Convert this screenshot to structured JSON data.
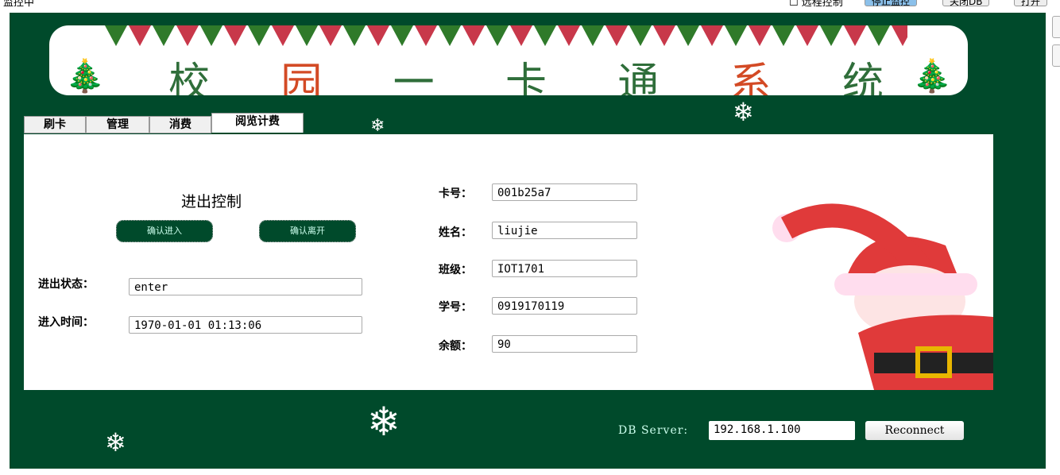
{
  "topbar": {
    "status": "监控中",
    "remote": "远程控制",
    "stop": "停止监控",
    "close_db": "关闭DB",
    "open": "打开"
  },
  "banner": {
    "title": [
      "校",
      "园",
      "一",
      "卡",
      "通",
      "系",
      "统"
    ]
  },
  "tabs": [
    "刷卡",
    "管理",
    "消费",
    "阅览计费"
  ],
  "access": {
    "heading": "进出控制",
    "enter_button": "确认进入",
    "leave_button": "确认离开",
    "status_label": "进出状态：",
    "status_value": "enter",
    "time_label": "进入时间：",
    "time_value": "1970-01-01  01:13:06"
  },
  "card": {
    "fields": [
      {
        "label": "卡号：",
        "value": "001b25a7"
      },
      {
        "label": "姓名：",
        "value": "liujie"
      },
      {
        "label": "班级：",
        "value": "IOT1701"
      },
      {
        "label": "学号：",
        "value": "0919170119"
      },
      {
        "label": "余额：",
        "value": "90"
      }
    ]
  },
  "db": {
    "label": "DB Server:",
    "value": "192.168.1.100",
    "reconnect": "Reconnect"
  },
  "colors": {
    "green": "#004a2b",
    "red": "#e03a3a"
  }
}
